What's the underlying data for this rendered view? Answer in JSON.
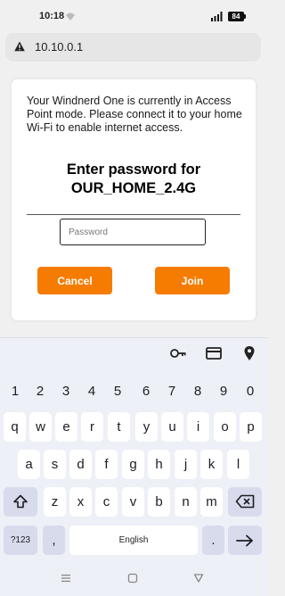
{
  "status_bar": {
    "time": "10:18",
    "signal_label": "4G",
    "battery": "84"
  },
  "url_bar": {
    "url": "10.10.0.1",
    "warning_icon": "warning-triangle-icon"
  },
  "dialog": {
    "message": "Your Windnerd One is currently in Access Point mode. Please connect it to your home Wi-Fi to enable internet access.",
    "title_line1": "Enter password for",
    "title_line2": "OUR_HOME_2.4G",
    "password_placeholder": "Password",
    "password_value": "",
    "cancel_label": "Cancel",
    "join_label": "Join",
    "accent_color": "#f57c00"
  },
  "keyboard": {
    "toolbar_icons": [
      "key-icon",
      "credit-card-icon",
      "location-pin-icon"
    ],
    "numbers": [
      "1",
      "2",
      "3",
      "4",
      "5",
      "6",
      "7",
      "8",
      "9",
      "0"
    ],
    "row1": [
      "q",
      "w",
      "e",
      "r",
      "t",
      "y",
      "u",
      "i",
      "o",
      "p"
    ],
    "row2": [
      "a",
      "s",
      "d",
      "f",
      "g",
      "h",
      "j",
      "k",
      "l"
    ],
    "row3": [
      "z",
      "x",
      "c",
      "v",
      "b",
      "n",
      "m"
    ],
    "symbols_label": "?123",
    "comma_label": ",",
    "space_label": "English",
    "period_label": "."
  },
  "navbar": {
    "icons": [
      "menu-icon",
      "home-square-icon",
      "back-triangle-icon"
    ]
  }
}
